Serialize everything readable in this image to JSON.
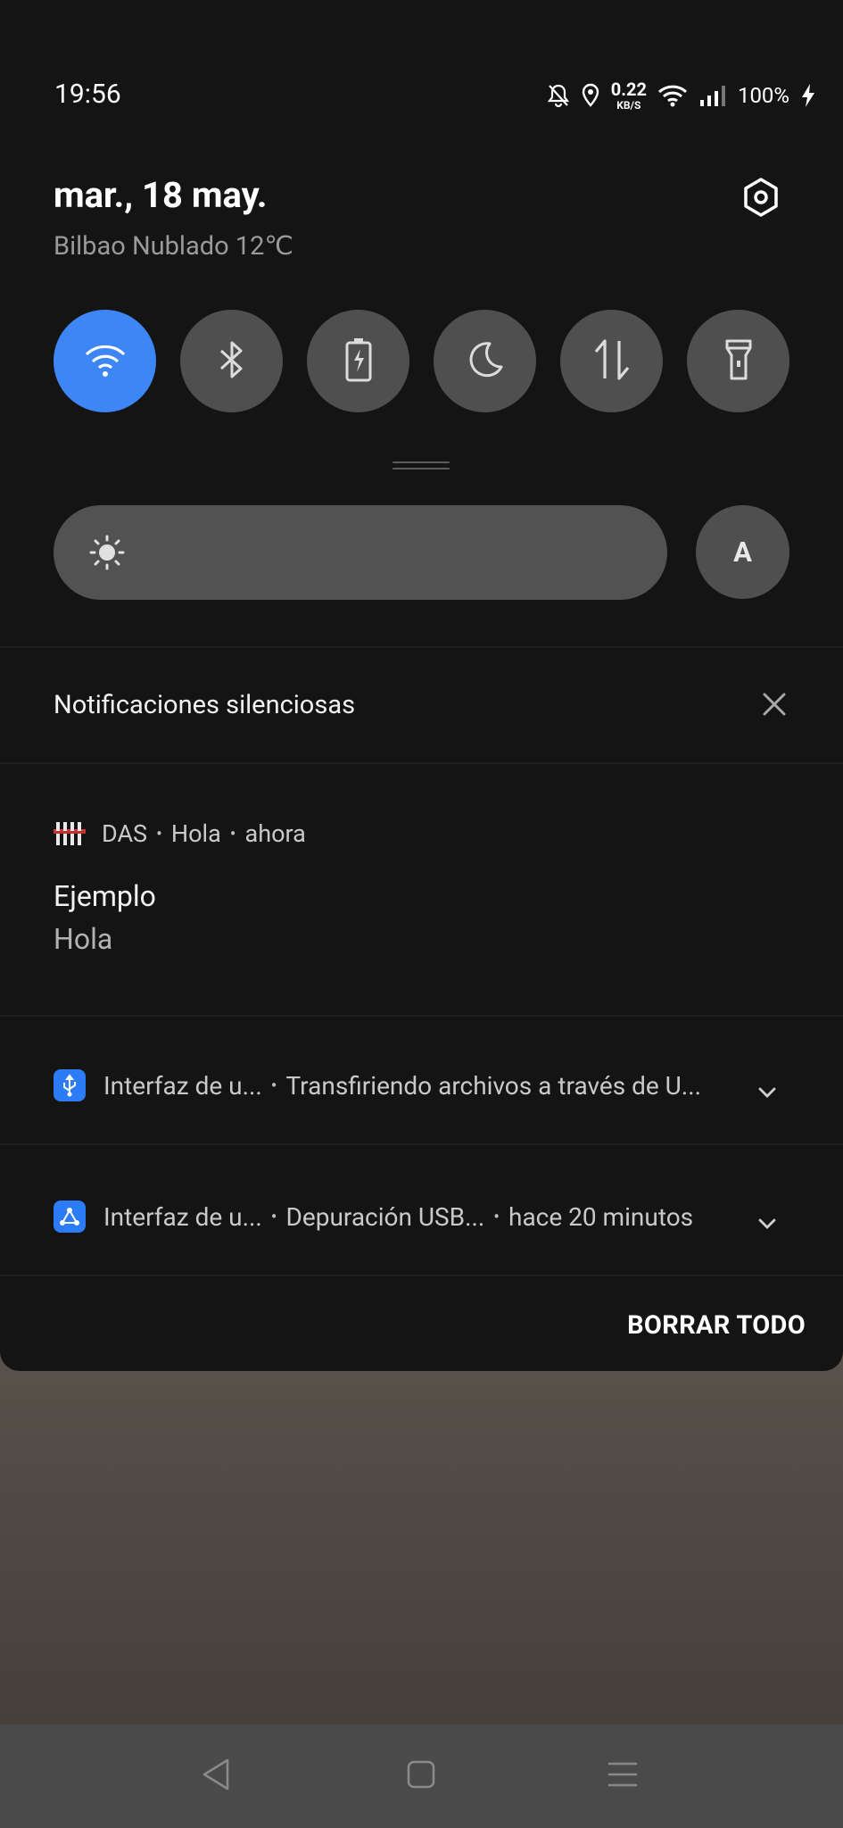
{
  "status_bar": {
    "time": "19:56",
    "net_speed_value": "0.22",
    "net_speed_unit": "KB/S",
    "battery": "100%",
    "icons": [
      "bell-off-icon",
      "location-icon",
      "wifi-icon",
      "signal-icon",
      "charging-bolt-icon"
    ]
  },
  "header": {
    "date": "mar., 18 may.",
    "weather": "Bilbao Nublado 12℃"
  },
  "quick_tiles": [
    {
      "name": "wifi",
      "icon": "wifi-icon",
      "active": true
    },
    {
      "name": "bluetooth",
      "icon": "bluetooth-icon",
      "active": false
    },
    {
      "name": "battery-saver",
      "icon": "battery-charging-icon",
      "active": false
    },
    {
      "name": "dark-mode",
      "icon": "moon-icon",
      "active": false
    },
    {
      "name": "mobile-data",
      "icon": "data-arrows-icon",
      "active": false
    },
    {
      "name": "flashlight",
      "icon": "flashlight-icon",
      "active": false
    }
  ],
  "brightness": {
    "auto_label": "A",
    "icon": "sun-icon"
  },
  "silent_section": {
    "title": "Notificaciones silenciosas"
  },
  "notifications": [
    {
      "app": "DAS",
      "subtitle": "Hola",
      "time": "ahora",
      "title": "Ejemplo",
      "text": "Hola"
    },
    {
      "app": "Interfaz de u...",
      "text": "Transfiriendo archivos a través de U...",
      "icon": "usb-icon"
    },
    {
      "app": "Interfaz de u...",
      "text": "Depuración USB...",
      "time": "hace 20 minutos",
      "icon": "usb-debug-icon"
    }
  ],
  "actions": {
    "clear_all": "BORRAR TODO"
  },
  "colors": {
    "accent": "#3d86f5",
    "panel": "#141414",
    "tile": "#4f4f4f"
  }
}
